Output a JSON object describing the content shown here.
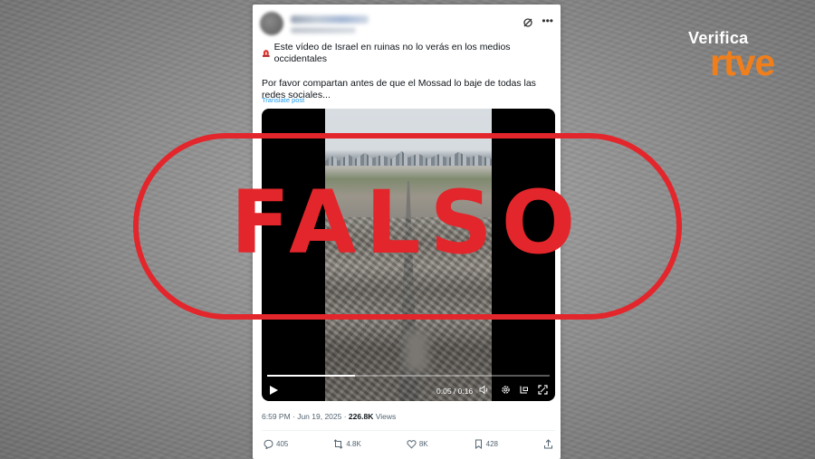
{
  "tweet": {
    "line1": "Este vídeo de Israel en ruinas no lo verás en los medios occidentales",
    "line2": "Por favor compartan antes de que el Mossad lo baje de todas las redes sociales...",
    "translate_label": "Translate post",
    "timestamp": "6:59 PM · Jun 19, 2025 · ",
    "views_count": "226.8K",
    "views_label": "Views"
  },
  "video": {
    "time": "0:05 / 0:16",
    "progress": 0.31
  },
  "actions": {
    "replies": "405",
    "reposts": "4.8K",
    "likes": "8K",
    "bookmarks": "428"
  },
  "stamp": {
    "text": "FALSO",
    "color": "#e3262b"
  },
  "logo": {
    "top": "Verifica",
    "bottom": "rtve",
    "accent": "#f07f1b"
  },
  "icons": [
    "avatar",
    "grok-icon",
    "more-icon",
    "siren-icon",
    "play-icon",
    "settings-icon",
    "pip-icon",
    "fullscreen-icon",
    "volume-icon",
    "reply-icon",
    "repost-icon",
    "like-icon",
    "bookmark-icon",
    "share-icon"
  ]
}
